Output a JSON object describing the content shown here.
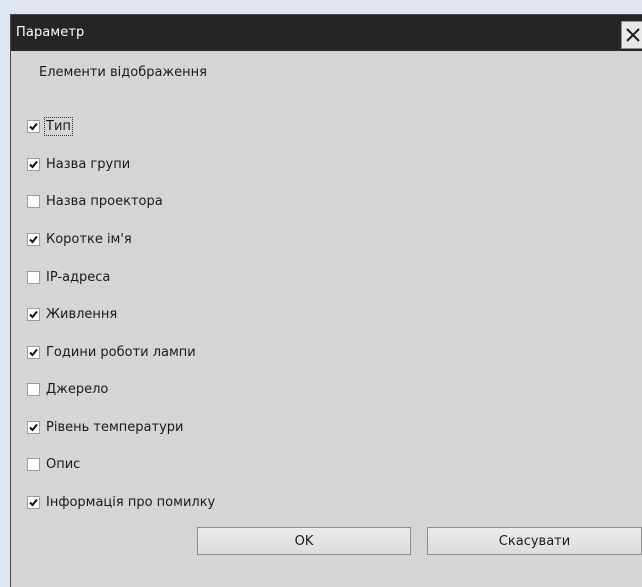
{
  "dialog": {
    "title": "Параметр",
    "section_label": "Елементи відображення",
    "options": [
      {
        "label": "Тип",
        "checked": true
      },
      {
        "label": "Назва групи",
        "checked": true
      },
      {
        "label": "Назва проектора",
        "checked": false
      },
      {
        "label": "Коротке ім'я",
        "checked": true
      },
      {
        "label": "IP-адреса",
        "checked": false
      },
      {
        "label": "Живлення",
        "checked": true
      },
      {
        "label": "Години роботи лампи",
        "checked": true
      },
      {
        "label": "Джерело",
        "checked": false
      },
      {
        "label": "Рівень температури",
        "checked": true
      },
      {
        "label": "Опис",
        "checked": false
      },
      {
        "label": "Інформація про помилку",
        "checked": true
      }
    ],
    "ok_label": "OK",
    "cancel_label": "Скасувати"
  },
  "icons": {
    "close": "close-icon",
    "check": "check-icon"
  },
  "colors": {
    "titlebar": "#252525",
    "dialog_bg": "#d5d5d5",
    "page_bg": "#dfe6f1"
  }
}
